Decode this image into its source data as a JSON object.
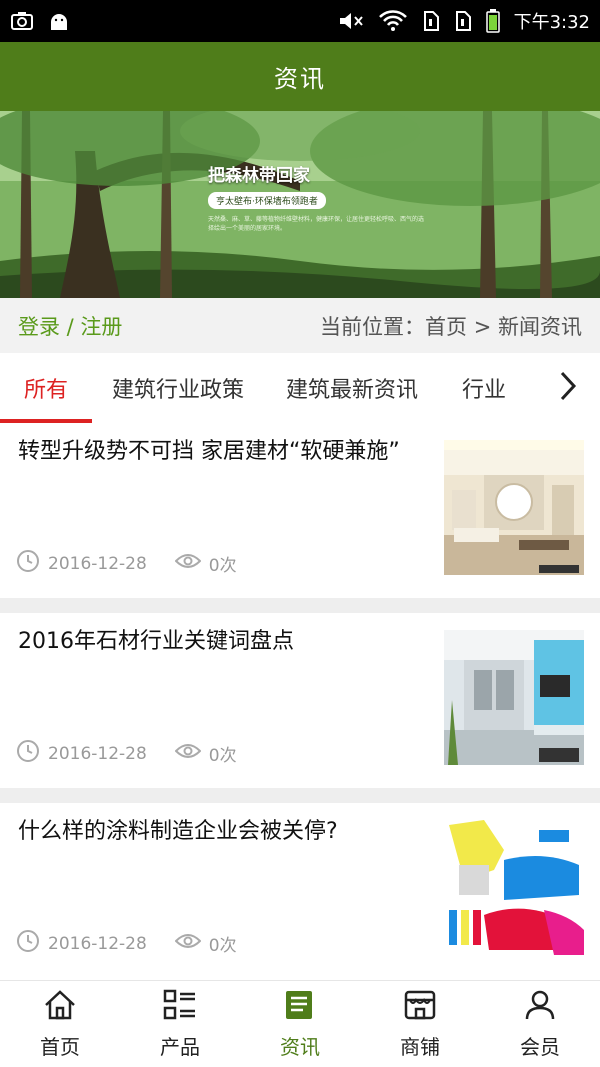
{
  "status_bar": {
    "time": "下午3:32"
  },
  "header": {
    "title": "资讯"
  },
  "banner": {
    "title": "把森林带回家",
    "badge": "亨太壁布·环保墙布领跑者",
    "desc": "天然桑、麻、草、藤等植物纤维壁材料，健康环保，让居住更轻松呼吸、西气的选择绘出一个美丽的居家环境。"
  },
  "login_bar": {
    "login_label": "登录 / 注册",
    "breadcrumb": "当前位置：首页 > 新闻资讯"
  },
  "tabs": [
    {
      "label": "所有",
      "active": true
    },
    {
      "label": "建筑行业政策",
      "active": false
    },
    {
      "label": "建筑最新资讯",
      "active": false
    },
    {
      "label": "行业",
      "active": false
    }
  ],
  "articles": [
    {
      "title": "转型升级势不可挡 家居建材“软硬兼施”",
      "date": "2016-12-28",
      "views": "0次",
      "thumb_icon": "living-room-photo"
    },
    {
      "title": "2016年石材行业关键词盘点",
      "date": "2016-12-28",
      "views": "0次",
      "thumb_icon": "tv-wall-room-photo"
    },
    {
      "title": "什么样的涂料制造企业会被关停?",
      "date": "2016-12-28",
      "views": "0次",
      "thumb_icon": "paint-rollers-photo"
    }
  ],
  "bottom_nav": [
    {
      "label": "首页",
      "icon": "home-icon",
      "active": false
    },
    {
      "label": "产品",
      "icon": "grid-list-icon",
      "active": false
    },
    {
      "label": "资讯",
      "icon": "document-icon",
      "active": true
    },
    {
      "label": "商铺",
      "icon": "store-icon",
      "active": false
    },
    {
      "label": "会员",
      "icon": "person-icon",
      "active": false
    }
  ],
  "colors": {
    "brand": "#4f7d1a",
    "tab_active": "#dd2222",
    "login": "#5a9a1b"
  }
}
